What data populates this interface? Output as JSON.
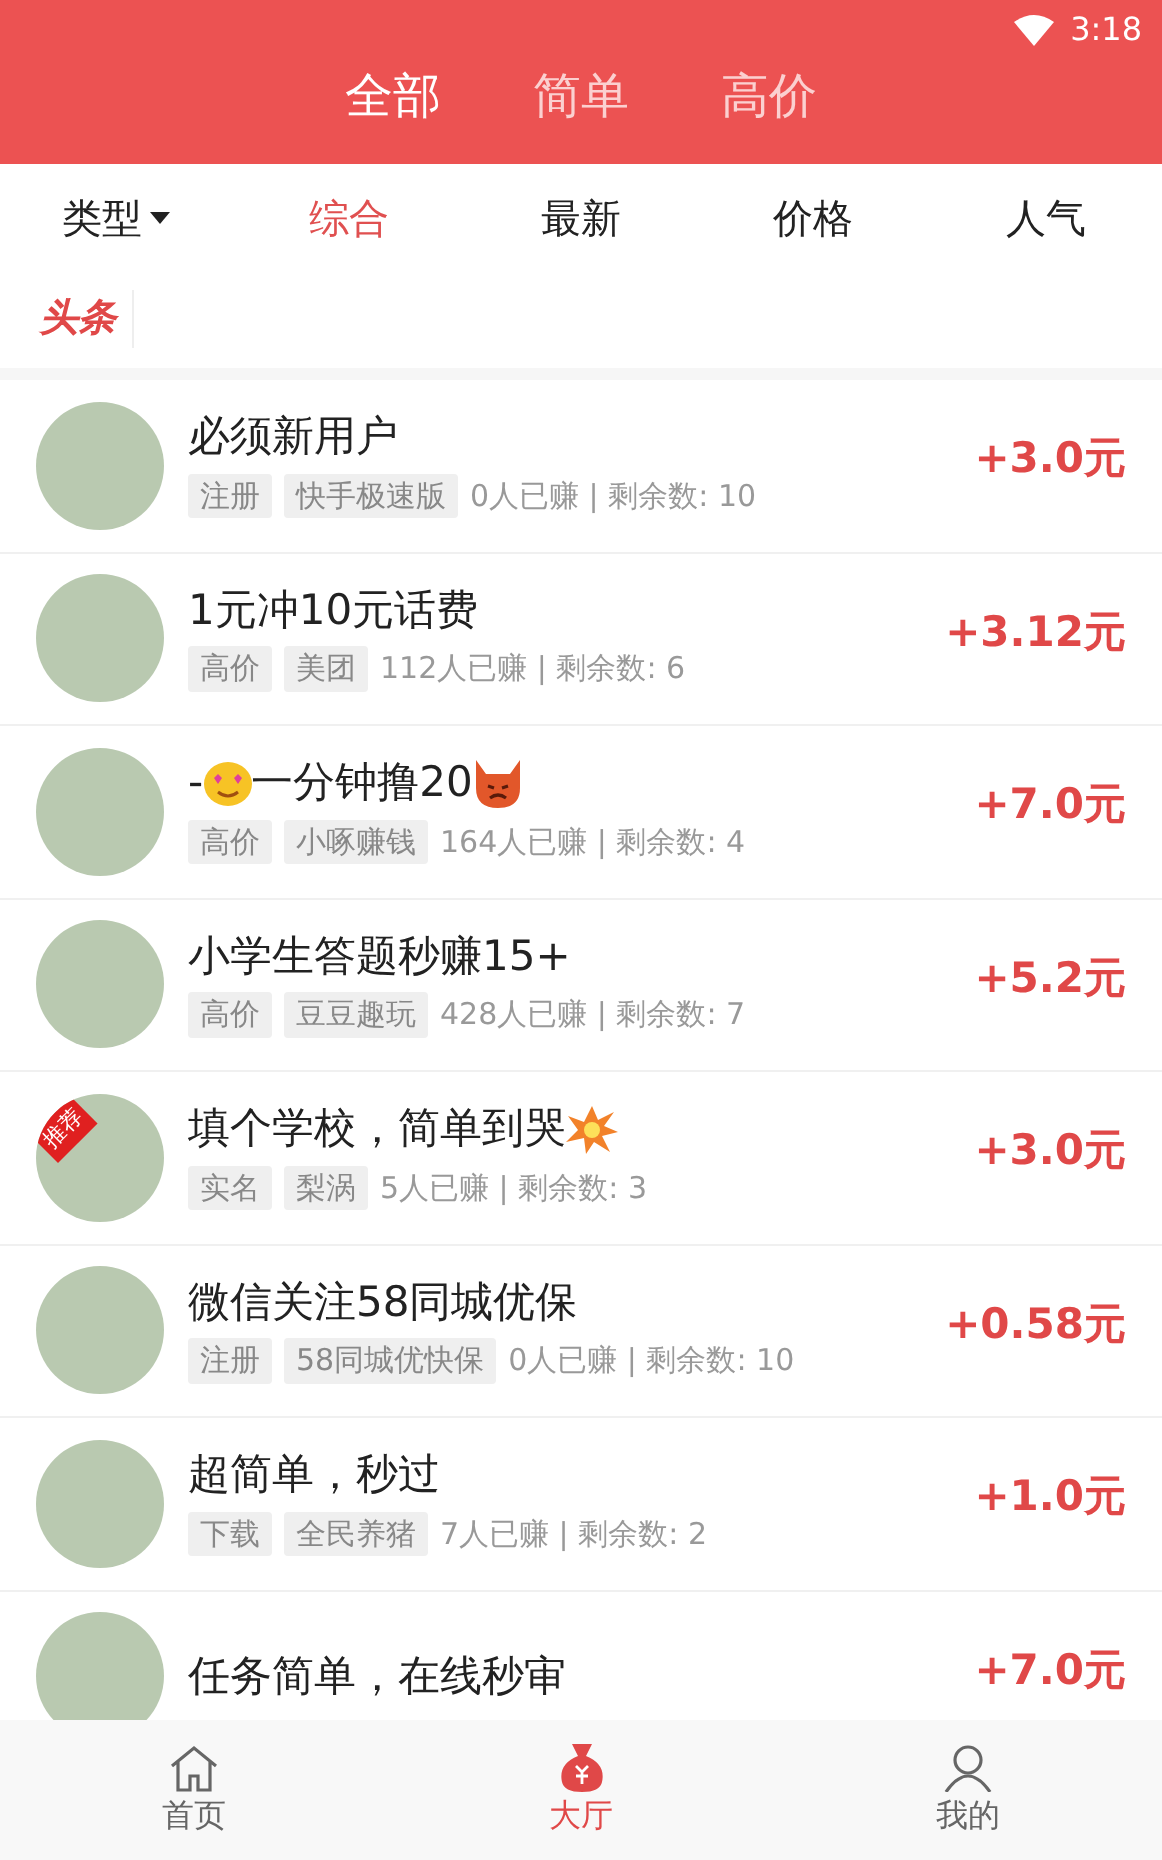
{
  "status_bar": {
    "time": "3:18"
  },
  "top_tabs": [
    {
      "label": "全部",
      "selected": true
    },
    {
      "label": "简单",
      "selected": false
    },
    {
      "label": "高价",
      "selected": false
    }
  ],
  "filters": [
    {
      "label": "类型",
      "kind": "dropdown",
      "selected": false
    },
    {
      "label": "综合",
      "kind": "sort",
      "selected": true
    },
    {
      "label": "最新",
      "kind": "sort",
      "selected": false
    },
    {
      "label": "价格",
      "kind": "sort",
      "selected": false
    },
    {
      "label": "人气",
      "kind": "sort",
      "selected": false
    }
  ],
  "headline": {
    "label": "头条"
  },
  "tasks": [
    {
      "title": [
        {
          "kind": "text",
          "text": "必须新用户"
        }
      ],
      "tags": [
        "注册",
        "快手极速版"
      ],
      "stats": "0人已赚 | 剩余数: 10",
      "reward": "+3.0元"
    },
    {
      "title": [
        {
          "kind": "text",
          "text": "1元冲10元话费"
        }
      ],
      "tags": [
        "高价",
        "美团"
      ],
      "stats": "112人已赚 | 剩余数: 6",
      "reward": "+3.12元"
    },
    {
      "title": [
        {
          "kind": "text",
          "text": "-"
        },
        {
          "kind": "smiley"
        },
        {
          "kind": "text",
          "text": "一分钟撸20"
        },
        {
          "kind": "devil"
        }
      ],
      "tags": [
        "高价",
        "小啄赚钱"
      ],
      "stats": "164人已赚 | 剩余数: 4",
      "reward": "+7.0元"
    },
    {
      "title": [
        {
          "kind": "text",
          "text": "小学生答题秒赚15+"
        }
      ],
      "tags": [
        "高价",
        "豆豆趣玩"
      ],
      "stats": "428人已赚 | 剩余数: 7",
      "reward": "+5.2元"
    },
    {
      "title": [
        {
          "kind": "text",
          "text": "填个学校，简单到哭"
        },
        {
          "kind": "burst"
        }
      ],
      "tags": [
        "实名",
        "梨涡"
      ],
      "stats": "5人已赚 | 剩余数: 3",
      "reward": "+3.0元",
      "badge": "推荐"
    },
    {
      "title": [
        {
          "kind": "text",
          "text": "微信关注58同城优保"
        }
      ],
      "tags": [
        "注册",
        "58同城优快保"
      ],
      "stats": "0人已赚 | 剩余数: 10",
      "reward": "+0.58元"
    },
    {
      "title": [
        {
          "kind": "text",
          "text": "超简单，秒过"
        }
      ],
      "tags": [
        "下载",
        "全民养猪"
      ],
      "stats": "7人已赚 | 剩余数: 2",
      "reward": "+1.0元"
    },
    {
      "title": [
        {
          "kind": "text",
          "text": "任务简单，在线秒审"
        }
      ],
      "reward": "+7.0元"
    }
  ],
  "bottom_nav": [
    {
      "label": "首页",
      "kind": "home",
      "selected": false
    },
    {
      "label": "大厅",
      "kind": "moneybag",
      "selected": true
    },
    {
      "label": "我的",
      "kind": "person",
      "selected": false
    }
  ]
}
